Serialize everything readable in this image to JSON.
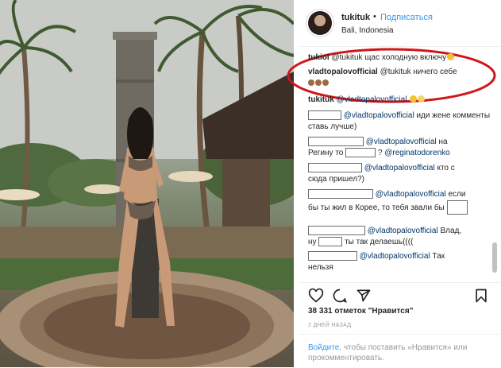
{
  "header": {
    "username": "tukituk",
    "dot": "•",
    "follow_label": "Подписаться",
    "location": "Bali, Indonesia"
  },
  "comments": [
    {
      "user": "tukiol",
      "text": "@tukituk щас холодную включу"
    },
    {
      "user": "vladtopalovofficial",
      "text": "@tukituk ничего себе"
    },
    {
      "user": "tukituk",
      "text": "@vladtopalovofficial"
    },
    {
      "mention": "@vladtopalovofficial",
      "text": "иди жене комменты ставь лучше)"
    },
    {
      "mention": "@vladtopalovofficial",
      "text_a": "на",
      "text_b": "Регину то",
      "text_c": "?",
      "mention2": "@reginatodorenko"
    },
    {
      "mention": "@vladtopalovofficial",
      "text_a": "кто с",
      "text_b": "сюда пришел?)"
    },
    {
      "mention": "@vladtopalovofficial",
      "text_a": "если",
      "text_b": "бы ты жил в Корее, то тебя звали бы"
    },
    {
      "mention": "@vladtopalovofficial",
      "text_a": "Влад,",
      "text_b": "ну",
      "text_c": "ты так делаешь(((("
    },
    {
      "mention": "@vladtopalovofficial",
      "text_a": "Так",
      "text_b": "нельзя"
    }
  ],
  "actions": {
    "likes": "38 331 отметок \"Нравится\"",
    "date": "2 ДНЕЙ НАЗАД"
  },
  "login": {
    "link": "Войдите",
    "text": ", чтобы поставить «Нравится» или прокомментировать."
  },
  "colors": {
    "link": "#3897f0",
    "mention": "#003569",
    "annotation": "#d0161b"
  },
  "icons": [
    "heart-icon",
    "comment-icon",
    "share-icon",
    "bookmark-icon"
  ]
}
